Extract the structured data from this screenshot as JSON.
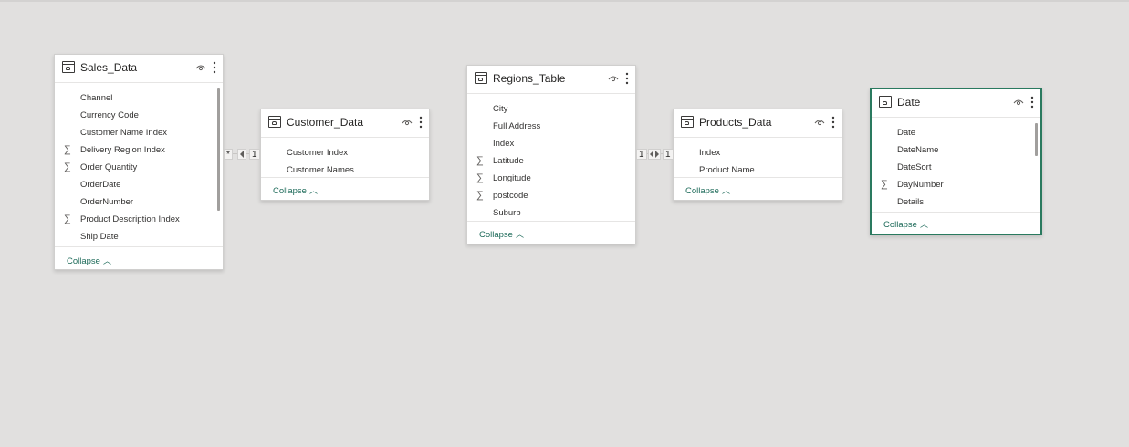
{
  "tables": [
    {
      "name": "Sales_Data",
      "fields": [
        {
          "name": "Channel",
          "sigma": ""
        },
        {
          "name": "Currency Code",
          "sigma": ""
        },
        {
          "name": "Customer Name Index",
          "sigma": ""
        },
        {
          "name": "Delivery Region Index",
          "sigma": "∑"
        },
        {
          "name": "Order Quantity",
          "sigma": "∑"
        },
        {
          "name": "OrderDate",
          "sigma": ""
        },
        {
          "name": "OrderNumber",
          "sigma": ""
        },
        {
          "name": "Product Description Index",
          "sigma": "∑"
        },
        {
          "name": "Ship Date",
          "sigma": ""
        }
      ],
      "collapse_label": "Collapse"
    },
    {
      "name": "Customer_Data",
      "fields": [
        {
          "name": "Customer Index",
          "sigma": ""
        },
        {
          "name": "Customer Names",
          "sigma": ""
        }
      ],
      "collapse_label": "Collapse"
    },
    {
      "name": "Regions_Table",
      "fields": [
        {
          "name": "City",
          "sigma": ""
        },
        {
          "name": "Full Address",
          "sigma": ""
        },
        {
          "name": "Index",
          "sigma": ""
        },
        {
          "name": "Latitude",
          "sigma": "∑"
        },
        {
          "name": "Longitude",
          "sigma": "∑"
        },
        {
          "name": "postcode",
          "sigma": "∑"
        },
        {
          "name": "Suburb",
          "sigma": ""
        }
      ],
      "collapse_label": "Collapse"
    },
    {
      "name": "Products_Data",
      "fields": [
        {
          "name": "Index",
          "sigma": ""
        },
        {
          "name": "Product Name",
          "sigma": ""
        }
      ],
      "collapse_label": "Collapse"
    },
    {
      "name": "Date",
      "fields": [
        {
          "name": "Date",
          "sigma": ""
        },
        {
          "name": "DateName",
          "sigma": ""
        },
        {
          "name": "DateSort",
          "sigma": ""
        },
        {
          "name": "DayNumber",
          "sigma": "∑"
        },
        {
          "name": "Details",
          "sigma": ""
        }
      ],
      "collapse_label": "Collapse"
    }
  ],
  "relationships": [
    {
      "from_card": "*",
      "to_card": "1"
    },
    {
      "from_card": "1",
      "to_card": "1"
    }
  ],
  "icons": {
    "table": "table-icon",
    "visibility": "eye-icon",
    "menu": "more-vertical-icon",
    "aggregate": "sigma-icon",
    "collapse": "chevron-up-icon"
  },
  "colors": {
    "canvas": "#e1e0df",
    "accent": "#2a7a5f",
    "link": "#1e6b5a"
  }
}
